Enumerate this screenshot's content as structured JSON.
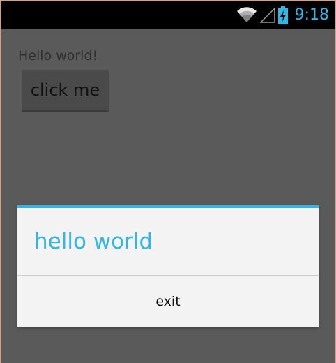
{
  "status_bar": {
    "time": "9:18",
    "icons": [
      "wifi-icon",
      "signal-icon",
      "battery-charging-icon"
    ],
    "accent_color": "#33b5e5"
  },
  "app": {
    "hello_text": "Hello world!",
    "button_label": "click me"
  },
  "dialog": {
    "title": "hello world",
    "button_label": "exit",
    "accent_color": "#33b5e5"
  }
}
